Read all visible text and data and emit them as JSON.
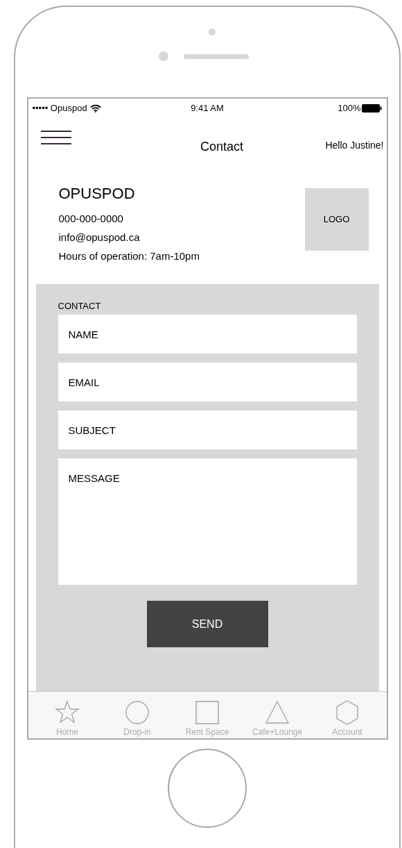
{
  "status_bar": {
    "carrier": "••••• Opuspod",
    "time": "9:41 AM",
    "battery": "100%"
  },
  "nav": {
    "title": "Contact",
    "greeting": "Hello Justine!"
  },
  "company": {
    "name": "OPUSPOD",
    "phone": "000-000-0000",
    "email": "info@opuspod.ca",
    "hours": "Hours of operation: 7am-10pm",
    "logo": "LOGO"
  },
  "form": {
    "heading": "CONTACT",
    "fields": [
      {
        "kind": "input",
        "placeholder": "NAME"
      },
      {
        "kind": "input",
        "placeholder": "EMAIL"
      },
      {
        "kind": "input",
        "placeholder": "SUBJECT"
      },
      {
        "kind": "textarea",
        "placeholder": "MESSAGE"
      }
    ],
    "button": "SEND"
  },
  "tab_bar": [
    {
      "label": "Home"
    },
    {
      "label": "Drop-in"
    },
    {
      "label": "Rent Space"
    },
    {
      "label": "Cafe+Lounge"
    },
    {
      "label": "Account"
    }
  ]
}
